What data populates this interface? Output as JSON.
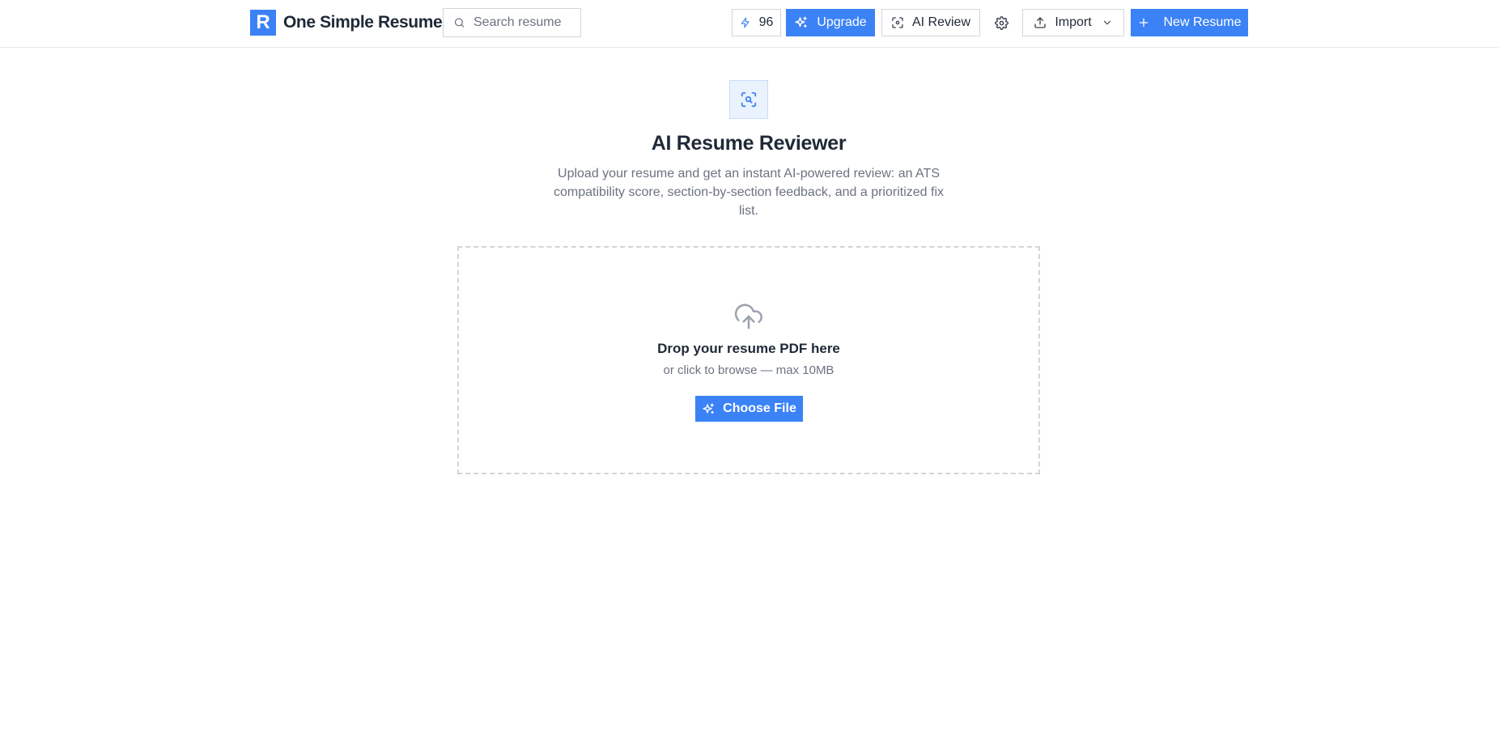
{
  "header": {
    "logo_letter": "R",
    "app_name": "One Simple Resume",
    "search_placeholder": "Search resume",
    "credits": "96",
    "upgrade_label": "Upgrade",
    "ai_review_label": "AI Review",
    "import_label": "Import",
    "new_resume_label": "New Resume"
  },
  "main": {
    "title": "AI Resume Reviewer",
    "subtitle": "Upload your resume and get an instant AI-powered review: an ATS compatibility score, section-by-section feedback, and a prioritized fix list.",
    "dropzone": {
      "title": "Drop your resume PDF here",
      "subtitle": "or click to browse — max 10MB",
      "button_label": "Choose File"
    }
  },
  "icons": {
    "logo": "logo-icon",
    "search": "search-icon",
    "credits": "lightning-icon",
    "upgrade": "sparkles-icon",
    "ai_review": "scan-icon",
    "settings": "gear-icon",
    "import": "upload-icon",
    "import_menu": "chevron-down-icon",
    "new_resume": "plus-icon",
    "hero": "scan-search-icon",
    "dropzone": "cloud-upload-icon",
    "choose_file": "sparkles-icon"
  },
  "colors": {
    "accent": "#3b82f6",
    "text": "#1f2937",
    "muted": "#6b7280",
    "border": "#d1d5db"
  }
}
